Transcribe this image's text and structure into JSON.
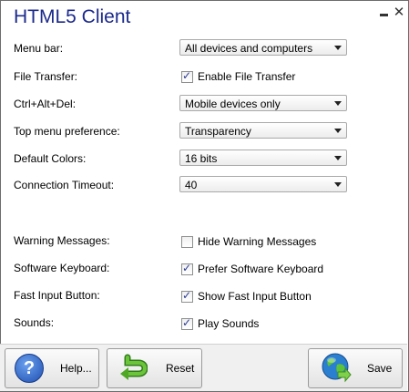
{
  "window": {
    "title": "HTML5 Client",
    "minimize_glyph": "",
    "close_glyph": "✕"
  },
  "settings": {
    "menu_bar": {
      "label": "Menu bar:",
      "value": "All devices and computers"
    },
    "file_transfer": {
      "label": "File Transfer:",
      "checkbox_label": "Enable File Transfer",
      "checked": true
    },
    "ctrl_alt_del": {
      "label": "Ctrl+Alt+Del:",
      "value": "Mobile devices only"
    },
    "top_menu_preference": {
      "label": "Top menu preference:",
      "value": "Transparency"
    },
    "default_colors": {
      "label": "Default Colors:",
      "value": "16 bits"
    },
    "connection_timeout": {
      "label": "Connection Timeout:",
      "value": "40"
    },
    "warning_messages": {
      "label": "Warning Messages:",
      "checkbox_label": "Hide Warning Messages",
      "checked": false
    },
    "software_keyboard": {
      "label": "Software Keyboard:",
      "checkbox_label": "Prefer Software Keyboard",
      "checked": true
    },
    "fast_input_button": {
      "label": "Fast Input Button:",
      "checkbox_label": "Show Fast Input Button",
      "checked": true
    },
    "sounds": {
      "label": "Sounds:",
      "checkbox_label": "Play Sounds",
      "checked": true
    }
  },
  "buttons": {
    "help": {
      "label": "Help...",
      "icon": "help-icon",
      "glyph": "?"
    },
    "reset": {
      "label": "Reset",
      "icon": "reset-arrow-icon"
    },
    "save": {
      "label": "Save",
      "icon": "globe-save-icon"
    }
  },
  "colors": {
    "title": "#1c2a8c",
    "reset_arrow": "#56b22c",
    "globe": "#2a7fd0"
  }
}
